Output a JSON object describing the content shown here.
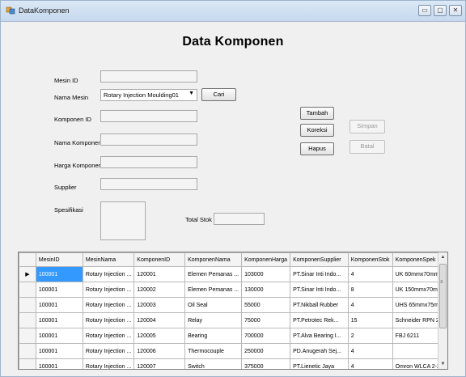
{
  "window": {
    "title": "DataKomponen",
    "controls": {
      "minimize": "▭",
      "maximize": "▢",
      "close": "✕"
    }
  },
  "heading": "Data Komponen",
  "form": {
    "mesin_id_label": "Mesin ID",
    "mesin_id_value": "",
    "nama_mesin_label": "Nama Mesin",
    "nama_mesin_value": "Rotary Injection Moulding01",
    "cari_label": "Cari",
    "komponen_id_label": "Komponen ID",
    "komponen_id_value": "",
    "nama_komponen_label": "Nama Komponen",
    "nama_komponen_value": "",
    "harga_komponen_label": "Harga Komponen",
    "harga_komponen_value": "",
    "supplier_label": "Supplier",
    "supplier_value": "",
    "spesifikasi_label": "Spesifikasi",
    "spesifikasi_value": "",
    "total_stok_label": "Total Stok",
    "total_stok_value": ""
  },
  "buttons": {
    "tambah": "Tambah",
    "koreksi": "Koreksi",
    "hapus": "Hapus",
    "simpan": "Simpan",
    "batal": "Batal"
  },
  "grid": {
    "columns": [
      "MesinID",
      "MesinNama",
      "KomponenID",
      "KomponenNama",
      "KomponenHarga",
      "KomponenSupplier",
      "KomponenStok",
      "KomponenSpek"
    ],
    "rows": [
      [
        "100001",
        "Rotary Injection ...",
        "120001",
        "Elemen Pemanas ...",
        "103000",
        "PT.Sinar Inti Indo...",
        "4",
        "UK 60mmx70mm"
      ],
      [
        "100001",
        "Rotary Injection ...",
        "120002",
        "Elemen Pemanas ...",
        "130000",
        "PT.Sinar Inti Indo...",
        "8",
        "UK 150mmx70mm"
      ],
      [
        "100001",
        "Rotary Injection ...",
        "120003",
        "Oil Seal",
        "55000",
        "PT.Nikball Rubber",
        "4",
        "UHS 65mmx75m..."
      ],
      [
        "100001",
        "Rotary Injection ...",
        "120004",
        "Relay",
        "75000",
        "PT.Petrotec Rek...",
        "15",
        "Schneider RPN 2..."
      ],
      [
        "100001",
        "Rotary Injection ...",
        "120005",
        "Bearing",
        "700000",
        "PT.Alva Bearing I...",
        "2",
        "FBJ 6211"
      ],
      [
        "100001",
        "Rotary Injection ...",
        "120006",
        "Thermocouple",
        "250000",
        "PD.Anugerah Sej...",
        "4",
        ""
      ],
      [
        "100001",
        "Rotary Injection ...",
        "120007",
        "Switch",
        "375000",
        "PT.Lienetic Jaya",
        "4",
        "Omron WLCA 2-2N"
      ]
    ],
    "selected_row_marker": "▶"
  },
  "colors": {
    "selection": "#3399ff",
    "titlebar": "#c7d9ee"
  },
  "icons": {
    "app": "app-icon",
    "combo": "chevron-down-icon"
  }
}
